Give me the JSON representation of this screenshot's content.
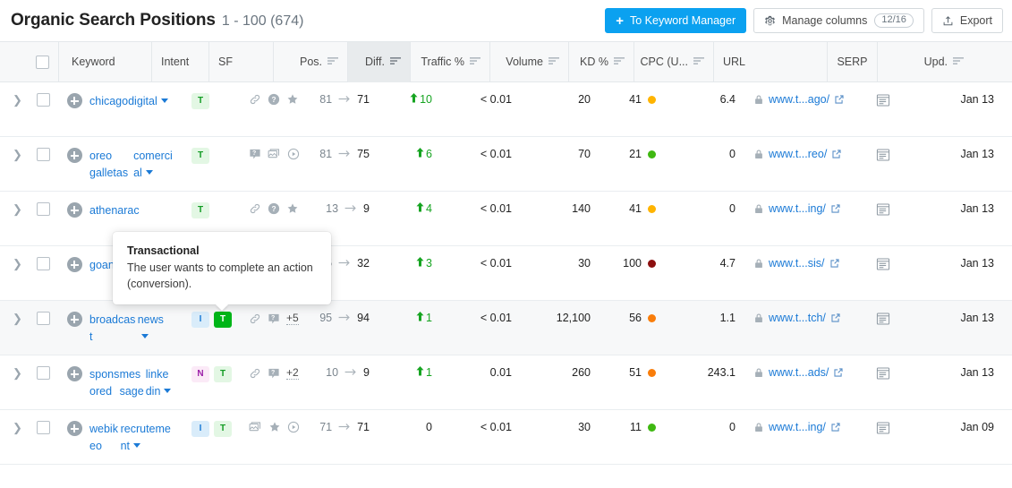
{
  "header": {
    "title": "Organic Search Positions",
    "range": "1 - 100 (674)",
    "to_keyword_manager": "To Keyword Manager",
    "plus": "+",
    "manage_columns": "Manage columns",
    "manage_columns_count": "12/16",
    "export": "Export"
  },
  "columns": [
    {
      "key": "keyword",
      "label": "Keyword",
      "sortable": false
    },
    {
      "key": "intent",
      "label": "Intent",
      "sortable": false
    },
    {
      "key": "sf",
      "label": "SF",
      "sortable": false
    },
    {
      "key": "pos",
      "label": "Pos.",
      "sortable": true
    },
    {
      "key": "diff",
      "label": "Diff.",
      "sortable": true,
      "sorted": true
    },
    {
      "key": "traffic",
      "label": "Traffic %",
      "sortable": true
    },
    {
      "key": "volume",
      "label": "Volume",
      "sortable": true
    },
    {
      "key": "kd",
      "label": "KD %",
      "sortable": true
    },
    {
      "key": "cpc",
      "label": "CPC (U...",
      "sortable": true
    },
    {
      "key": "url",
      "label": "URL",
      "sortable": false
    },
    {
      "key": "serp",
      "label": "SERP",
      "sortable": false
    },
    {
      "key": "upd",
      "label": "Upd.",
      "sortable": true
    }
  ],
  "tooltip": {
    "title": "Transactional",
    "body": "The user wants to complete an action (conversion)."
  },
  "intent_colors": {
    "T_bg": "#e3f7e4",
    "T_fg": "#119b22",
    "T_active_bg": "#00b518",
    "T_active_fg": "#ffffff",
    "I_bg": "#d9ecfa",
    "I_fg": "#1b7ad6",
    "N_bg": "#fbeaf7",
    "N_fg": "#9b1fa8"
  },
  "kd_colors": {
    "green": "#3fb811",
    "yellow": "#ffb400",
    "orange": "#f97d0a",
    "darkred": "#8c0f0f"
  },
  "accent": "#0ba1f0",
  "rows": [
    {
      "keyword": [
        "chicago",
        "digital"
      ],
      "keyword_truncated": false,
      "intent": [
        {
          "letter": "T",
          "style": "T"
        }
      ],
      "sf": [
        "link-icon",
        "question-circle-icon",
        "star-icon"
      ],
      "sf_more": "",
      "pos_old": "81",
      "pos_new": "71",
      "diff": "10",
      "diff_dir": "up",
      "traffic": "< 0.01",
      "volume": "20",
      "kd": "41",
      "kd_color": "yellow",
      "cpc": "6.4",
      "url": "www.t...ago/",
      "upd": "Jan 13",
      "hovered": false
    },
    {
      "keyword": [
        "oreo galletas",
        "comercial"
      ],
      "keyword_truncated": false,
      "intent": [
        {
          "letter": "T",
          "style": "T"
        }
      ],
      "sf": [
        "faq-icon",
        "image-icon",
        "video-icon"
      ],
      "sf_more": "",
      "pos_old": "81",
      "pos_new": "75",
      "diff": "6",
      "diff_dir": "up",
      "traffic": "< 0.01",
      "volume": "70",
      "kd": "21",
      "kd_color": "green",
      "cpc": "0",
      "url": "www.t...reo/",
      "upd": "Jan 13",
      "hovered": false
    },
    {
      "keyword": [
        "athena",
        "rac"
      ],
      "keyword_truncated": true,
      "intent": [
        {
          "letter": "T",
          "style": "T"
        }
      ],
      "sf": [
        "link-icon",
        "question-circle-icon",
        "star-icon"
      ],
      "sf_more": "",
      "pos_old": "13",
      "pos_new": "9",
      "diff": "4",
      "diff_dir": "up",
      "traffic": "< 0.01",
      "volume": "140",
      "kd": "41",
      "kd_color": "yellow",
      "cpc": "0",
      "url": "www.t...ing/",
      "upd": "Jan 13",
      "hovered": false
    },
    {
      "keyword": [
        "go",
        "an"
      ],
      "keyword_truncated": true,
      "intent": [],
      "sf": [],
      "sf_more": "",
      "pos_old": "35",
      "pos_new": "32",
      "diff": "3",
      "diff_dir": "up",
      "traffic": "< 0.01",
      "volume": "30",
      "kd": "100",
      "kd_color": "darkred",
      "cpc": "4.7",
      "url": "www.t...sis/",
      "upd": "Jan 13",
      "hovered": false
    },
    {
      "keyword": [
        "broadcast",
        "news"
      ],
      "keyword_truncated": false,
      "intent": [
        {
          "letter": "I",
          "style": "I"
        },
        {
          "letter": "T",
          "style": "T_active"
        }
      ],
      "sf": [
        "link-icon",
        "faq-icon"
      ],
      "sf_more": "+5",
      "pos_old": "95",
      "pos_new": "94",
      "diff": "1",
      "diff_dir": "up",
      "traffic": "< 0.01",
      "volume": "12,100",
      "kd": "56",
      "kd_color": "orange",
      "cpc": "1.1",
      "url": "www.t...tch/",
      "upd": "Jan 13",
      "hovered": true
    },
    {
      "keyword": [
        "sponsored",
        "message",
        "linkedin"
      ],
      "keyword_truncated": false,
      "intent": [
        {
          "letter": "N",
          "style": "N"
        },
        {
          "letter": "T",
          "style": "T"
        }
      ],
      "sf": [
        "link-icon",
        "faq-icon"
      ],
      "sf_more": "+2",
      "pos_old": "10",
      "pos_new": "9",
      "diff": "1",
      "diff_dir": "up",
      "traffic": "0.01",
      "volume": "260",
      "kd": "51",
      "kd_color": "orange",
      "cpc": "243.1",
      "url": "www.t...ads/",
      "upd": "Jan 13",
      "hovered": false
    },
    {
      "keyword": [
        "webikeo",
        "recrutement"
      ],
      "keyword_truncated": false,
      "intent": [
        {
          "letter": "I",
          "style": "I"
        },
        {
          "letter": "T",
          "style": "T"
        }
      ],
      "sf": [
        "image-icon",
        "star-icon",
        "video-icon"
      ],
      "sf_more": "",
      "pos_old": "71",
      "pos_new": "71",
      "diff": "0",
      "diff_dir": "none",
      "traffic": "< 0.01",
      "volume": "30",
      "kd": "11",
      "kd_color": "green",
      "cpc": "0",
      "url": "www.t...ing/",
      "upd": "Jan 09",
      "hovered": false
    }
  ]
}
